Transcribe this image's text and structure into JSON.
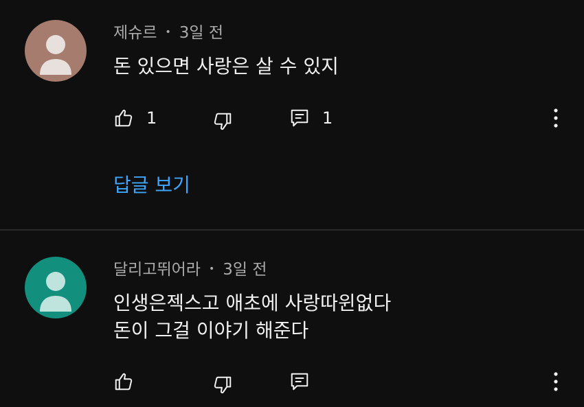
{
  "comments": [
    {
      "author": "제슈르",
      "separator": "•",
      "time": "3일 전",
      "text_lines": [
        "돈 있으면 사랑은 살 수 있지"
      ],
      "like_count": "1",
      "reply_count": "1",
      "view_replies_label": "답글 보기",
      "avatar_color": "#a67c6f",
      "avatar_figure_color": "#e8e0dd"
    },
    {
      "author": "달리고뛰어라",
      "separator": "•",
      "time": "3일 전",
      "text_lines": [
        "인생은젝스고 애초에 사랑따윈없다",
        "돈이 그걸 이야기 해준다"
      ],
      "like_count": "",
      "reply_count": "",
      "avatar_color": "#138f7e",
      "avatar_figure_color": "#bfe4de"
    }
  ],
  "icons": {
    "like": "thumbs-up-icon",
    "dislike": "thumbs-down-icon",
    "reply": "reply-comment-icon",
    "more": "more-vertical-icon"
  },
  "colors": {
    "background": "#0f0f0f",
    "link": "#3ea6ff",
    "meta_text": "#aaaaaa",
    "divider": "#2a2a2a"
  }
}
